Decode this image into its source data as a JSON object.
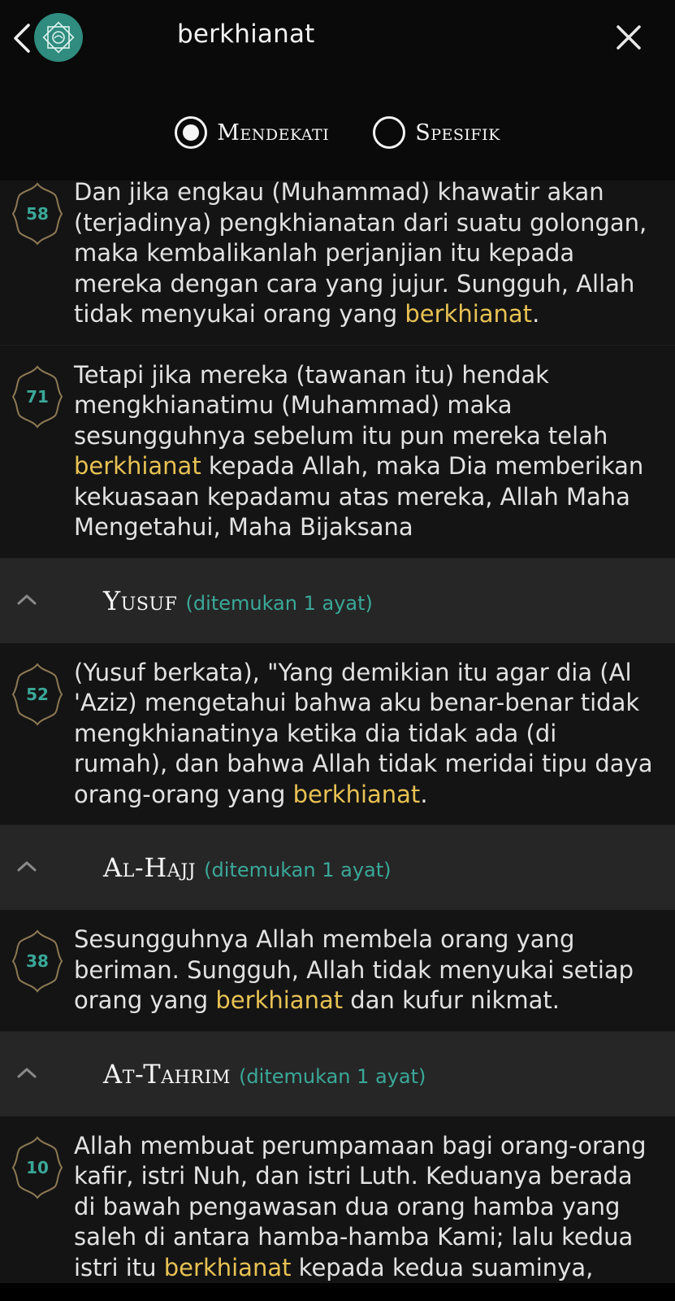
{
  "header": {
    "back_icon": "chevron-left-icon",
    "logo_icon": "quran-logo-icon",
    "search_query": "berkhianat",
    "clear_icon": "close-icon"
  },
  "search_mode": {
    "options": [
      {
        "label": "Mendekati",
        "selected": true
      },
      {
        "label": "Spesifik",
        "selected": false
      }
    ]
  },
  "colors": {
    "highlight": "#e8c253",
    "accent": "#3aa898",
    "logo_bg": "#2f8c7f",
    "header_bg": "#262626",
    "ayah_bg": "#141414"
  },
  "results": {
    "a58": {
      "number": "58",
      "pre": "Dan jika engkau (Muhammad) khawatir akan (terjadinya) pengkhianatan dari suatu golongan, maka kembalikanlah perjanjian itu kepada mereka dengan cara yang jujur. Sungguh, Allah tidak menyukai orang yang ",
      "match": "berkhianat",
      "post": "."
    },
    "a71": {
      "number": "71",
      "pre": "Tetapi jika mereka (tawanan itu) hendak mengkhianatimu (Muhammad) maka sesungguhnya sebelum itu pun mereka telah ",
      "match": "berkhianat",
      "post": " kepada Allah, maka Dia memberikan kekuasaan kepadamu atas mereka, Allah Maha Mengetahui, Maha Bijaksana"
    },
    "yusuf": {
      "name": "Yusuf",
      "count": "(ditemukan 1 ayat)"
    },
    "a52": {
      "number": "52",
      "pre": "(Yusuf berkata), \"Yang demikian itu agar dia (Al 'Aziz) mengetahui bahwa aku benar-benar tidak mengkhianatinya ketika dia tidak ada (di rumah), dan bahwa Allah tidak meridai tipu daya orang-orang yang ",
      "match": "berkhianat",
      "post": "."
    },
    "alhajj": {
      "name": "Al-Hajj",
      "count": "(ditemukan 1 ayat)"
    },
    "a38": {
      "number": "38",
      "pre": "Sesungguhnya Allah membela orang yang beriman. Sungguh, Allah tidak menyukai setiap orang yang ",
      "match": "berkhianat",
      "post": " dan kufur nikmat."
    },
    "attahrim": {
      "name": "At-Tahrim",
      "count": "(ditemukan 1 ayat)"
    },
    "a10": {
      "number": "10",
      "pre": "Allah membuat perumpamaan bagi orang-orang kafir, istri Nuh, dan istri Luth. Keduanya berada di bawah pengawasan dua orang hamba yang saleh di antara hamba-hamba Kami; lalu kedua istri itu ",
      "match": "berkhianat",
      "post": " kepada kedua suaminya, tetapi kedua"
    }
  }
}
